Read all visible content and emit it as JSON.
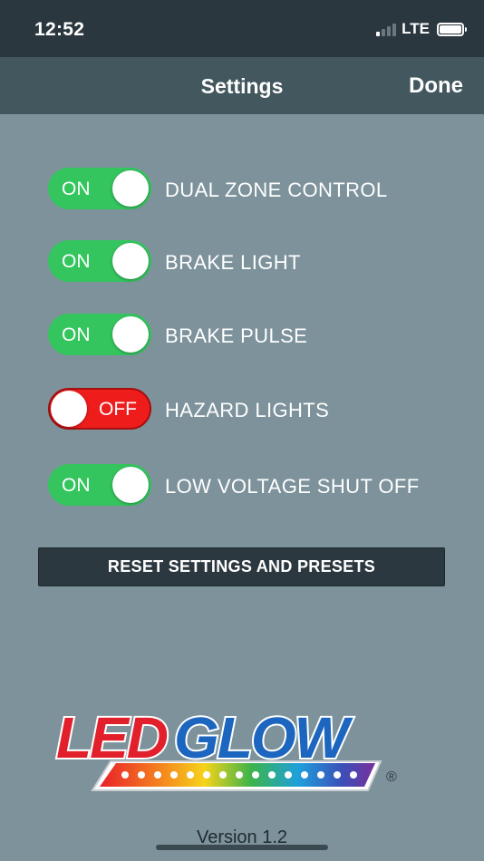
{
  "status_bar": {
    "time": "12:52",
    "network": "LTE",
    "signal_bars_filled": 1,
    "signal_bars_total": 4,
    "battery_level": 1.0
  },
  "nav": {
    "title": "Settings",
    "done_label": "Done"
  },
  "settings": [
    {
      "label": "DUAL ZONE CONTROL",
      "state": "ON"
    },
    {
      "label": "BRAKE LIGHT",
      "state": "ON"
    },
    {
      "label": "BRAKE PULSE",
      "state": "ON"
    },
    {
      "label": "HAZARD LIGHTS",
      "state": "OFF"
    },
    {
      "label": "LOW VOLTAGE SHUT OFF",
      "state": "ON"
    }
  ],
  "reset_button": {
    "label": "RESET SETTINGS AND PRESETS"
  },
  "logo": {
    "text_led": "LED",
    "text_glow": "GLOW",
    "registered_mark": "®",
    "colors": {
      "led_red": "#e2202b",
      "glow_blue": "#1c66c0",
      "outline": "#ffffff"
    }
  },
  "footer": {
    "version": "Version 1.2"
  },
  "colors": {
    "background": "#7d929b",
    "status_bar": "#2b373e",
    "nav_bar": "#43575f",
    "toggle_on": "#34c55e",
    "toggle_off": "#ef1c1c",
    "button_dark": "#2c383f"
  }
}
